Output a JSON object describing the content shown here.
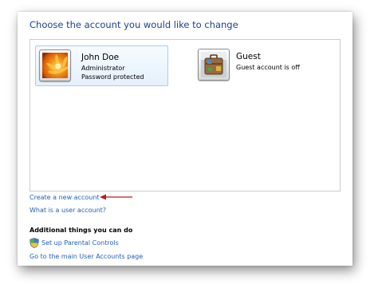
{
  "heading": "Choose the account you would like to change",
  "accounts": [
    {
      "name": "John Doe",
      "line1": "Administrator",
      "line2": "Password protected",
      "picture": "orange-flower-icon"
    },
    {
      "name": "Guest",
      "line1": "Guest account is off",
      "picture": "suitcase-icon"
    }
  ],
  "links": {
    "create": "Create a new account",
    "what": "What is a user account?"
  },
  "additional": {
    "title": "Additional things you can do",
    "parental": "Set up Parental Controls",
    "main_page": "Go to the main User Accounts page"
  },
  "colors": {
    "heading": "#1e3f8f",
    "link": "#1f5fbd",
    "annotation_arrow": "#b01e1e",
    "selection_border": "#a9cdea"
  }
}
